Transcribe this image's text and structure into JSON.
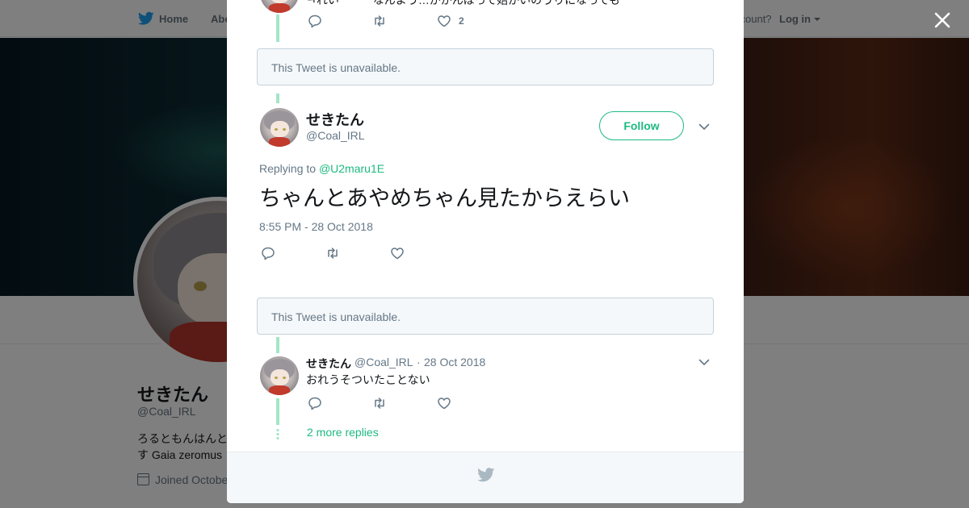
{
  "background": {
    "nav": {
      "home_label": "Home",
      "about_label": "Abo",
      "account_prompt": "ccount?",
      "login_label": "Log in"
    },
    "profile": {
      "name": "せきたん",
      "handle": "@Coal_IRL",
      "bio": "ろるともんはんと す Gaia zeromus",
      "joined": "Joined Octobe"
    }
  },
  "modal": {
    "top_tweet": {
      "text_fragment": "ㅋれい　　　なんよう…ががんばって始かいのうりになっても",
      "like_count": "2"
    },
    "unavailable_1": "This Tweet is unavailable.",
    "main_tweet": {
      "name": "せきたん",
      "handle": "@Coal_IRL",
      "follow_label": "Follow",
      "replying_prefix": "Replying to",
      "replying_to": "@U2maru1E",
      "text": "ちゃんとあやめちゃん見たからえらい",
      "timestamp": "8:55 PM - 28 Oct 2018"
    },
    "unavailable_2": "This Tweet is unavailable.",
    "reply_tweet": {
      "name": "せきたん",
      "handle": "@Coal_IRL",
      "separator": "·",
      "date": "28 Oct 2018",
      "text": "おれうそついたことない"
    },
    "more_replies_label": "2 more replies"
  },
  "icons": {
    "close": "close-icon",
    "twitter_bird": "twitter-bird-icon",
    "reply": "reply-icon",
    "retweet": "retweet-icon",
    "like": "heart-icon",
    "chevron": "chevron-down-icon",
    "calendar": "calendar-icon"
  },
  "colors": {
    "accent": "#1dba80",
    "thread_line": "#a3e6c8",
    "secondary_text": "#657786",
    "primary_text": "#14171a",
    "twitter_blue": "#1da1f2"
  }
}
